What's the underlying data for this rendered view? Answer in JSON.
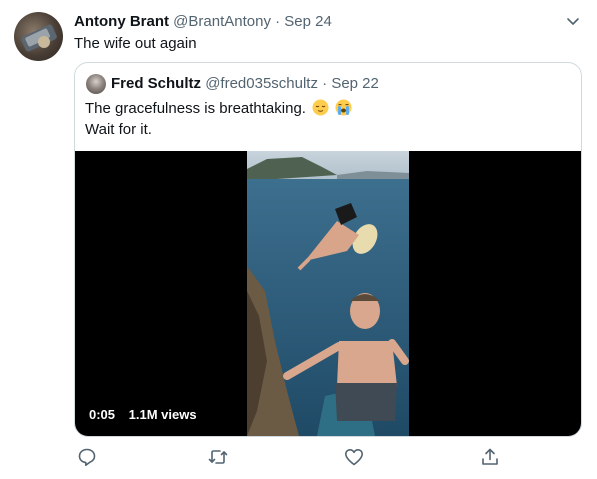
{
  "tweet": {
    "author_name": "Antony Brant",
    "author_handle": "@BrantAntony",
    "separator": "·",
    "date": "Sep 24",
    "text": "The wife out again"
  },
  "quoted": {
    "author_name": "Fred Schultz",
    "author_handle": "@fred035schultz",
    "separator": "·",
    "date": "Sep 22",
    "text_line1": "The gracefulness is breathtaking.",
    "text_line2": "Wait for it.",
    "emojis": [
      "relieved-face-icon",
      "loudly-crying-face-icon"
    ],
    "video": {
      "duration": "0:05",
      "views": "1.1M views"
    }
  },
  "actions": [
    "reply-icon",
    "retweet-icon",
    "like-icon",
    "share-icon"
  ],
  "colors": {
    "muted": "#536471",
    "border": "#cfd9de",
    "text": "#0f1419"
  }
}
